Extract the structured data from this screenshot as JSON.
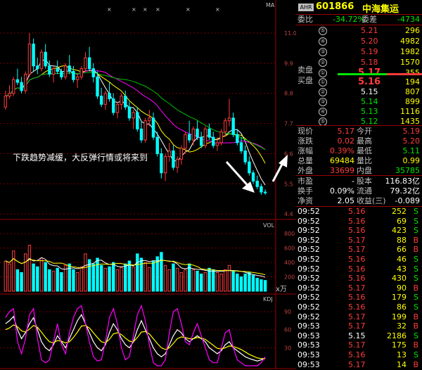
{
  "header": {
    "tag": "AHR",
    "code": "601866",
    "name": "中海集运"
  },
  "weibi": {
    "label1": "委比",
    "val1": "-34.72%",
    "label2": "委差",
    "val2": "-4734"
  },
  "sell_label": "卖盘",
  "buy_label": "买盘",
  "sells": [
    {
      "n": "⑤",
      "price": "5.21",
      "vol": "296"
    },
    {
      "n": "④",
      "price": "5.20",
      "vol": "4982"
    },
    {
      "n": "③",
      "price": "5.19",
      "vol": "1982"
    },
    {
      "n": "②",
      "price": "5.18",
      "vol": "1570"
    },
    {
      "n": "①",
      "price": "5.17",
      "vol": "355"
    }
  ],
  "buys": [
    {
      "n": "①",
      "price": "5.16",
      "vol": "194"
    },
    {
      "n": "②",
      "price": "5.15",
      "vol": "807"
    },
    {
      "n": "③",
      "price": "5.14",
      "vol": "899"
    },
    {
      "n": "④",
      "price": "5.13",
      "vol": "1116"
    },
    {
      "n": "⑤",
      "price": "5.12",
      "vol": "1435"
    }
  ],
  "quote": [
    {
      "l1": "现价",
      "v1": "5.17",
      "l2": "今开",
      "v2": "5.19"
    },
    {
      "l1": "涨跌",
      "v1": "0.02",
      "l2": "最高",
      "v2": "5.20"
    },
    {
      "l1": "涨幅",
      "v1": "0.39%",
      "l2": "最低",
      "v2": "5.11"
    },
    {
      "l1": "总量",
      "v1": "69484",
      "l2": "量比",
      "v2": "0.99"
    },
    {
      "l1": "外盘",
      "v1": "33699",
      "l2": "内盘",
      "v2": "35785"
    }
  ],
  "capital": [
    {
      "l1": "市盈",
      "v1": "-",
      "l2": "股本",
      "v2": "116.83亿"
    },
    {
      "l1": "换手",
      "v1": "0.09%",
      "l2": "流通",
      "v2": "79.32亿"
    },
    {
      "l1": "净资",
      "v1": "2.05",
      "l2": "收益(三)",
      "v2": "-0.089"
    }
  ],
  "ticks": [
    {
      "t": "09:52",
      "p": "5.16",
      "v": "252",
      "s": "S"
    },
    {
      "t": "09:52",
      "p": "5.16",
      "v": "69",
      "s": "S"
    },
    {
      "t": "09:52",
      "p": "5.16",
      "v": "423",
      "s": "S"
    },
    {
      "t": "09:52",
      "p": "5.17",
      "v": "88",
      "s": "B"
    },
    {
      "t": "09:52",
      "p": "5.17",
      "v": "66",
      "s": "B"
    },
    {
      "t": "09:52",
      "p": "5.16",
      "v": "46",
      "s": "S"
    },
    {
      "t": "09:52",
      "p": "5.16",
      "v": "43",
      "s": "S"
    },
    {
      "t": "09:52",
      "p": "5.16",
      "v": "430",
      "s": "S"
    },
    {
      "t": "09:52",
      "p": "5.17",
      "v": "90",
      "s": "B"
    },
    {
      "t": "09:52",
      "p": "5.16",
      "v": "179",
      "s": "S"
    },
    {
      "t": "09:52",
      "p": "5.16",
      "v": "86",
      "s": "S"
    },
    {
      "t": "09:52",
      "p": "5.17",
      "v": "199",
      "s": "B"
    },
    {
      "t": "09:53",
      "p": "5.17",
      "v": "32",
      "b": 1,
      "s": "B"
    },
    {
      "t": "09:53",
      "p": "5.15",
      "v": "2186",
      "s": "S"
    },
    {
      "t": "09:53",
      "p": "5.17",
      "v": "175",
      "s": "B"
    },
    {
      "t": "09:53",
      "p": "5.16",
      "v": "13",
      "s": "S"
    },
    {
      "t": "09:53",
      "p": "5.17",
      "v": "14",
      "s": "B"
    }
  ],
  "chart_data": {
    "type": "candlestick",
    "ma_label": "MA",
    "annotation": "下跌趋势减缓，大反弹行情或将来到",
    "price_ticks": [
      "11.0",
      "9.9",
      "8.8",
      "7.7",
      "6.6",
      "5.5",
      "4.4"
    ],
    "vol_label": "VOL",
    "vol_ticks": [
      "800",
      "600",
      "400",
      "200"
    ],
    "vol_unit": "x万",
    "kdj_label": "KDJ",
    "kdj_ticks": [
      "90",
      "60",
      "30"
    ],
    "ylim": [
      4.2,
      12.0
    ],
    "candles": [
      [
        8.3,
        8.9,
        8.2,
        8.7
      ],
      [
        8.7,
        9.1,
        8.6,
        8.8
      ],
      [
        8.8,
        9.4,
        8.7,
        9.3
      ],
      [
        9.3,
        9.7,
        9.1,
        9.2
      ],
      [
        9.2,
        9.4,
        8.8,
        8.9
      ],
      [
        8.9,
        9.6,
        8.8,
        9.5
      ],
      [
        9.5,
        11.0,
        9.4,
        10.6
      ],
      [
        10.6,
        10.8,
        9.6,
        9.8
      ],
      [
        9.8,
        10.1,
        9.5,
        9.7
      ],
      [
        9.7,
        10.4,
        9.6,
        10.3
      ],
      [
        10.3,
        10.6,
        9.7,
        9.8
      ],
      [
        9.8,
        10.0,
        9.4,
        9.5
      ],
      [
        9.5,
        9.8,
        9.2,
        9.7
      ],
      [
        9.7,
        10.0,
        9.5,
        9.6
      ],
      [
        9.6,
        9.7,
        9.3,
        9.4
      ],
      [
        9.4,
        9.9,
        9.3,
        9.8
      ],
      [
        9.8,
        10.2,
        9.5,
        9.6
      ],
      [
        9.6,
        9.8,
        9.2,
        9.3
      ],
      [
        9.3,
        9.5,
        9.0,
        9.4
      ],
      [
        9.4,
        9.8,
        9.3,
        9.7
      ],
      [
        9.7,
        10.3,
        9.6,
        10.1
      ],
      [
        10.1,
        10.5,
        9.6,
        9.7
      ],
      [
        9.7,
        9.9,
        9.2,
        9.4
      ],
      [
        9.4,
        9.6,
        8.6,
        8.7
      ],
      [
        8.7,
        9.0,
        8.3,
        8.4
      ],
      [
        8.4,
        8.9,
        8.2,
        8.8
      ],
      [
        8.8,
        9.2,
        8.5,
        8.6
      ],
      [
        8.6,
        8.8,
        8.0,
        8.1
      ],
      [
        8.1,
        8.5,
        7.9,
        8.4
      ],
      [
        8.4,
        8.8,
        8.2,
        8.7
      ],
      [
        8.7,
        8.9,
        8.2,
        8.3
      ],
      [
        8.3,
        8.5,
        7.8,
        7.9
      ],
      [
        7.9,
        8.2,
        7.5,
        8.1
      ],
      [
        8.1,
        8.3,
        7.4,
        7.5
      ],
      [
        7.5,
        7.8,
        7.0,
        7.1
      ],
      [
        7.1,
        7.9,
        7.0,
        7.8
      ],
      [
        7.8,
        8.2,
        7.6,
        7.9
      ],
      [
        7.9,
        8.1,
        7.1,
        7.2
      ],
      [
        7.2,
        7.4,
        6.5,
        6.6
      ],
      [
        6.6,
        6.8,
        5.7,
        5.9
      ],
      [
        5.9,
        6.6,
        5.6,
        6.5
      ],
      [
        6.5,
        7.0,
        6.3,
        6.7
      ],
      [
        6.7,
        6.9,
        6.0,
        6.1
      ],
      [
        6.1,
        6.5,
        5.9,
        6.4
      ],
      [
        6.4,
        6.9,
        6.2,
        6.8
      ],
      [
        6.8,
        7.4,
        6.6,
        7.3
      ],
      [
        7.3,
        7.8,
        7.0,
        7.1
      ],
      [
        7.1,
        7.6,
        6.9,
        7.5
      ],
      [
        7.5,
        7.8,
        7.1,
        7.2
      ],
      [
        7.2,
        7.4,
        6.8,
        6.9
      ],
      [
        6.9,
        7.6,
        6.8,
        7.5
      ],
      [
        7.5,
        7.7,
        7.1,
        7.2
      ],
      [
        7.2,
        7.4,
        6.8,
        6.9
      ],
      [
        6.9,
        7.2,
        6.7,
        7.0
      ],
      [
        7.0,
        7.5,
        6.9,
        7.4
      ],
      [
        7.4,
        7.9,
        7.2,
        7.8
      ],
      [
        7.8,
        8.6,
        7.6,
        7.9
      ],
      [
        7.9,
        8.1,
        7.2,
        7.3
      ],
      [
        7.3,
        7.5,
        6.9,
        7.0
      ],
      [
        7.0,
        7.2,
        6.6,
        6.7
      ],
      [
        6.7,
        6.9,
        6.2,
        6.3
      ],
      [
        6.3,
        6.5,
        5.8,
        5.9
      ],
      [
        5.9,
        6.0,
        5.5,
        5.6
      ],
      [
        5.6,
        5.8,
        5.3,
        5.4
      ],
      [
        5.4,
        5.5,
        5.1,
        5.2
      ],
      [
        5.2,
        5.3,
        5.1,
        5.17
      ]
    ],
    "volumes": [
      420,
      380,
      560,
      300,
      260,
      520,
      640,
      380,
      340,
      460,
      400,
      300,
      280,
      320,
      260,
      360,
      380,
      300,
      260,
      340,
      520,
      440,
      380,
      460,
      360,
      320,
      340,
      400,
      300,
      330,
      380,
      420,
      340,
      520,
      460,
      400,
      330,
      420,
      480,
      540,
      360,
      300,
      380,
      320,
      260,
      300,
      380,
      300,
      280,
      240,
      260,
      320,
      300,
      260,
      240,
      300,
      360,
      280,
      240,
      200,
      240,
      260,
      220,
      180,
      160,
      150
    ],
    "k": [
      70,
      75,
      82,
      60,
      45,
      55,
      70,
      80,
      60,
      40,
      30,
      25,
      35,
      50,
      40,
      30,
      45,
      60,
      75,
      85,
      70,
      55,
      40,
      30,
      25,
      35,
      55,
      70,
      60,
      45,
      35,
      30,
      40,
      60,
      75,
      60,
      45,
      30,
      20,
      15,
      20,
      35,
      50,
      60,
      55,
      45,
      40,
      45,
      50,
      45,
      40,
      30,
      25,
      20,
      25,
      35,
      40,
      30,
      25,
      20,
      15,
      12,
      10,
      8,
      10,
      12
    ],
    "j": [
      80,
      90,
      95,
      40,
      20,
      45,
      85,
      95,
      45,
      10,
      5,
      10,
      40,
      70,
      35,
      20,
      55,
      80,
      95,
      100,
      70,
      40,
      15,
      8,
      10,
      40,
      80,
      95,
      70,
      30,
      10,
      15,
      50,
      85,
      100,
      75,
      35,
      5,
      0,
      0,
      10,
      55,
      90,
      95,
      70,
      40,
      35,
      55,
      70,
      50,
      30,
      10,
      5,
      5,
      30,
      55,
      60,
      30,
      10,
      5,
      0,
      0,
      0,
      0,
      5,
      15
    ],
    "d": [
      60,
      63,
      68,
      65,
      58,
      56,
      61,
      67,
      64,
      56,
      47,
      40,
      38,
      42,
      41,
      38,
      40,
      47,
      56,
      66,
      67,
      63,
      55,
      47,
      40,
      38,
      44,
      53,
      55,
      52,
      46,
      41,
      40,
      47,
      56,
      57,
      53,
      45,
      37,
      30,
      27,
      30,
      37,
      45,
      48,
      47,
      45,
      45,
      47,
      46,
      44,
      39,
      34,
      29,
      28,
      30,
      33,
      32,
      30,
      27,
      23,
      19,
      16,
      13,
      12,
      12
    ]
  }
}
